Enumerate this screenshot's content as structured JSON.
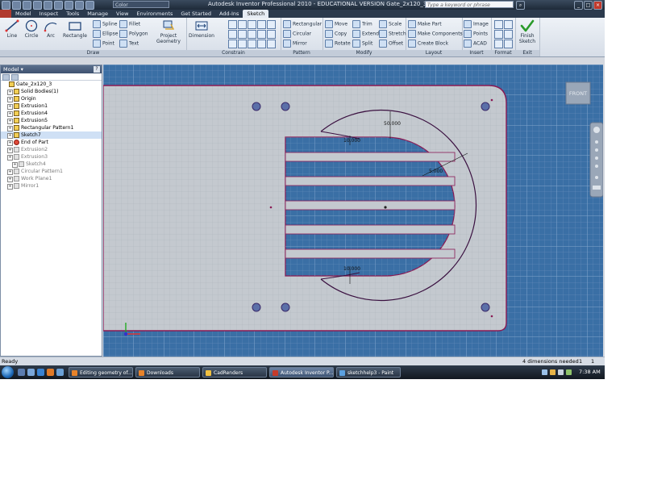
{
  "window": {
    "title": "Autodesk Inventor Professional 2010 - EDUCATIONAL VERSION    Gate_2x120_3",
    "color_box": "Color",
    "search_placeholder": "Type a keyword or phrase"
  },
  "menu_tabs": [
    "Model",
    "Inspect",
    "Tools",
    "Manage",
    "View",
    "Environments",
    "Get Started",
    "Add-Ins",
    "Sketch"
  ],
  "active_tab": "Sketch",
  "ribbon": {
    "draw": {
      "title": "Draw",
      "line": "Line",
      "circle": "Circle",
      "arc": "Arc",
      "rectangle": "Rectangle",
      "spline": "Spline",
      "ellipse": "Ellipse",
      "point": "Point",
      "fillet": "Fillet",
      "polygon": "Polygon",
      "text": "Text",
      "project_geometry": "Project Geometry"
    },
    "constrain": {
      "title": "Constrain",
      "dimension": "Dimension"
    },
    "pattern": {
      "title": "Pattern",
      "rectangular": "Rectangular",
      "circular": "Circular",
      "mirror": "Mirror"
    },
    "modify": {
      "title": "Modify",
      "move": "Move",
      "copy": "Copy",
      "rotate": "Rotate",
      "trim": "Trim",
      "extend": "Extend",
      "split": "Split",
      "scale": "Scale",
      "stretch": "Stretch",
      "offset": "Offset"
    },
    "layout": {
      "title": "Layout",
      "make_part": "Make Part",
      "make_components": "Make Components",
      "create_block": "Create Block"
    },
    "insert": {
      "title": "Insert",
      "image": "Image",
      "points": "Points",
      "acad": "ACAD"
    },
    "format": {
      "title": "Format"
    },
    "exit": {
      "title": "Exit",
      "finish_sketch": "Finish Sketch"
    }
  },
  "browser": {
    "header": "Model",
    "help": "?",
    "items": [
      {
        "label": "Gate_2x120_3",
        "level": 0,
        "style": "normal"
      },
      {
        "label": "Solid Bodies(1)",
        "level": 1,
        "style": "normal"
      },
      {
        "label": "Origin",
        "level": 1,
        "style": "normal"
      },
      {
        "label": "Extrusion1",
        "level": 1,
        "style": "normal"
      },
      {
        "label": "Extrusion4",
        "level": 1,
        "style": "normal"
      },
      {
        "label": "Extrusion5",
        "level": 1,
        "style": "normal"
      },
      {
        "label": "Rectangular Pattern1",
        "level": 1,
        "style": "normal"
      },
      {
        "label": "Sketch7",
        "level": 1,
        "style": "selected"
      },
      {
        "label": "End of Part",
        "level": 1,
        "style": "normal"
      },
      {
        "label": "Extrusion2",
        "level": 1,
        "style": "dim"
      },
      {
        "label": "Extrusion3",
        "level": 1,
        "style": "dim"
      },
      {
        "label": "Sketch4",
        "level": 2,
        "style": "dim"
      },
      {
        "label": "Circular Pattern1",
        "level": 1,
        "style": "dim"
      },
      {
        "label": "Work Plane1",
        "level": 1,
        "style": "dim"
      },
      {
        "label": "Mirror1",
        "level": 1,
        "style": "dim"
      }
    ]
  },
  "viewport": {
    "viewcube_label": "FRONT",
    "dimensions": [
      "50.000",
      "10.000",
      "5.000",
      "10.000"
    ]
  },
  "status": {
    "left": "Ready",
    "dims_needed": "4 dimensions needed",
    "count1": "1",
    "count2": "1"
  },
  "taskbar": {
    "tasks": [
      {
        "label": "Editing geometry of...",
        "active": false,
        "color": "#e8832a"
      },
      {
        "label": "Downloads",
        "active": false,
        "color": "#e8832a"
      },
      {
        "label": "CadRenders",
        "active": false,
        "color": "#f0c040"
      },
      {
        "label": "Autodesk Inventor P...",
        "active": true,
        "color": "#c63b2b"
      },
      {
        "label": "sketchhelp3 - Paint",
        "active": false,
        "color": "#5aa0e0"
      }
    ],
    "clock": "7:38 AM"
  },
  "colors": {
    "sheet": "#3a6fa5",
    "plate": "#c4c9cf",
    "plate_edge": "#8a1a54",
    "grid": "#6f95bf",
    "ribbon": "#e3e9f1"
  }
}
